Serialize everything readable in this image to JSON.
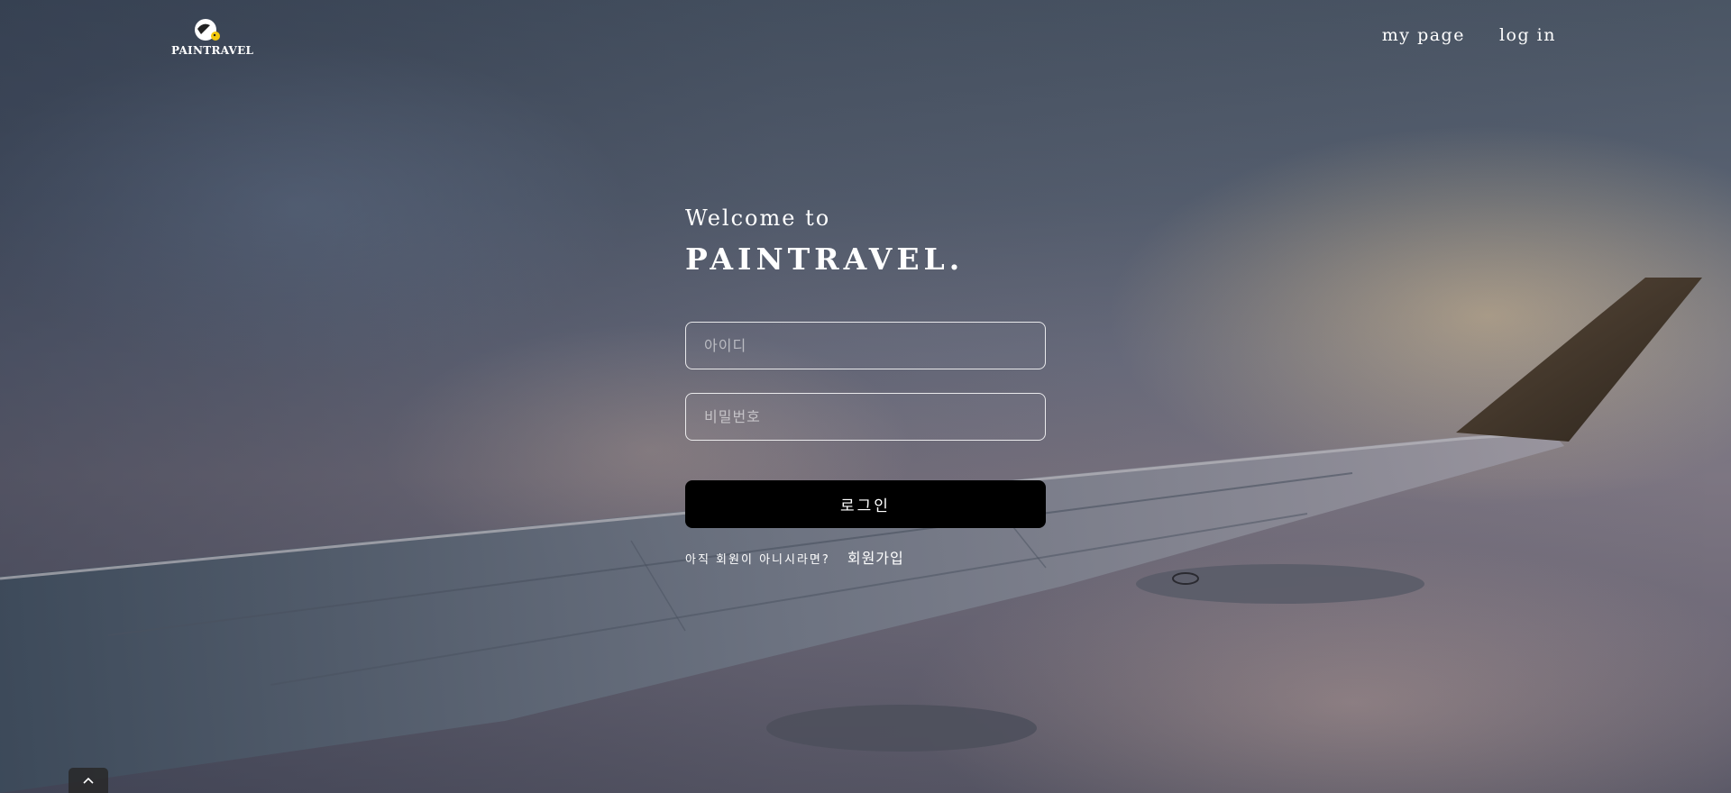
{
  "header": {
    "logo_text": "PAINTRAVEL",
    "logo_icon": "paintravel-logo-icon",
    "nav": {
      "my_page": "my page",
      "log_in": "log in"
    }
  },
  "login": {
    "welcome": "Welcome to",
    "brand": "PAINTRAVEL.",
    "id_placeholder": "아이디",
    "id_value": "",
    "pw_placeholder": "비밀번호",
    "pw_value": "",
    "submit_label": "로그인",
    "signup_hint": "아직 회원이 아니시라면?",
    "signup_link": "회원가입"
  },
  "scroll_top_icon": "chevron-up-icon",
  "colors": {
    "button_bg": "#000000",
    "text": "#ffffff"
  }
}
